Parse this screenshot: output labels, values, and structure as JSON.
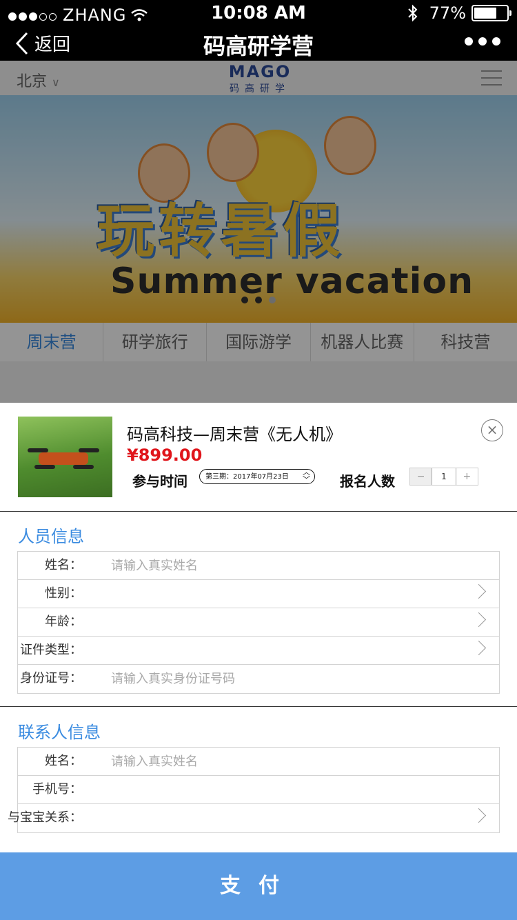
{
  "status_bar": {
    "carrier": "ZHANG",
    "time": "10:08 AM",
    "battery_text": "77%",
    "battery_level": 0.77
  },
  "nav": {
    "back_label": "返回",
    "title": "码高研学营"
  },
  "site_header": {
    "city": "北京",
    "logo_mark": "MAGO",
    "logo_cn": "码高研学"
  },
  "banner": {
    "headline": "玩转暑假",
    "subline": "Summer vacation",
    "slide_count": 3,
    "active_slide": 2
  },
  "categories": [
    {
      "label": "周末营",
      "active": true
    },
    {
      "label": "研学旅行",
      "active": false
    },
    {
      "label": "国际游学",
      "active": false
    },
    {
      "label": "机器人比赛",
      "active": false
    },
    {
      "label": "科技营",
      "active": false
    }
  ],
  "product": {
    "name": "码高科技—周末营《无人机》",
    "price": "¥899.00",
    "time_label": "参与时间",
    "period": "第三期：2017年07月23日",
    "count_label": "报名人数",
    "minus": "−",
    "plus": "+",
    "quantity": "1",
    "close": "×"
  },
  "person_info": {
    "title": "人员信息",
    "rows": [
      {
        "label": "姓名：",
        "placeholder": "请输入真实姓名"
      },
      {
        "label": "性别：",
        "placeholder": ""
      },
      {
        "label": "年龄：",
        "placeholder": ""
      },
      {
        "label": "证件类型：",
        "placeholder": ""
      },
      {
        "label": "身份证号：",
        "placeholder": "请输入真实身份证号码"
      }
    ]
  },
  "contact_info": {
    "title": "联系人信息",
    "rows": [
      {
        "label": "姓名：",
        "placeholder": "请输入真实姓名"
      },
      {
        "label": "手机号：",
        "placeholder": ""
      },
      {
        "label": "与宝宝关系：",
        "placeholder": ""
      }
    ]
  },
  "pay_button": "支付",
  "colors": {
    "accent_blue": "#3a8be0",
    "pay_button": "#5d9de4",
    "price_red": "#e0151b"
  }
}
